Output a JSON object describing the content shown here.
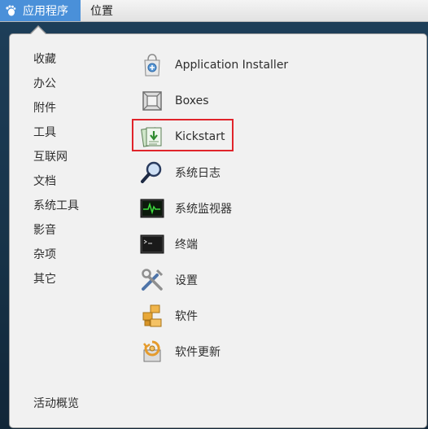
{
  "topbar": {
    "apps_label": "应用程序",
    "places_label": "位置"
  },
  "categories": [
    "收藏",
    "办公",
    "附件",
    "工具",
    "互联网",
    "文档",
    "系统工具",
    "影音",
    "杂项",
    "其它"
  ],
  "apps": [
    {
      "label": "Application Installer",
      "icon": "application-installer-icon"
    },
    {
      "label": "Boxes",
      "icon": "boxes-icon"
    },
    {
      "label": "Kickstart",
      "icon": "kickstart-icon"
    },
    {
      "label": "系统日志",
      "icon": "system-log-icon"
    },
    {
      "label": "系统监视器",
      "icon": "system-monitor-icon"
    },
    {
      "label": "终端",
      "icon": "terminal-icon"
    },
    {
      "label": "设置",
      "icon": "settings-icon"
    },
    {
      "label": "软件",
      "icon": "software-icon"
    },
    {
      "label": "软件更新",
      "icon": "software-update-icon"
    }
  ],
  "activities_label": "活动概览",
  "colors": {
    "accent": "#4a90d9",
    "highlight": "#e0242b"
  }
}
